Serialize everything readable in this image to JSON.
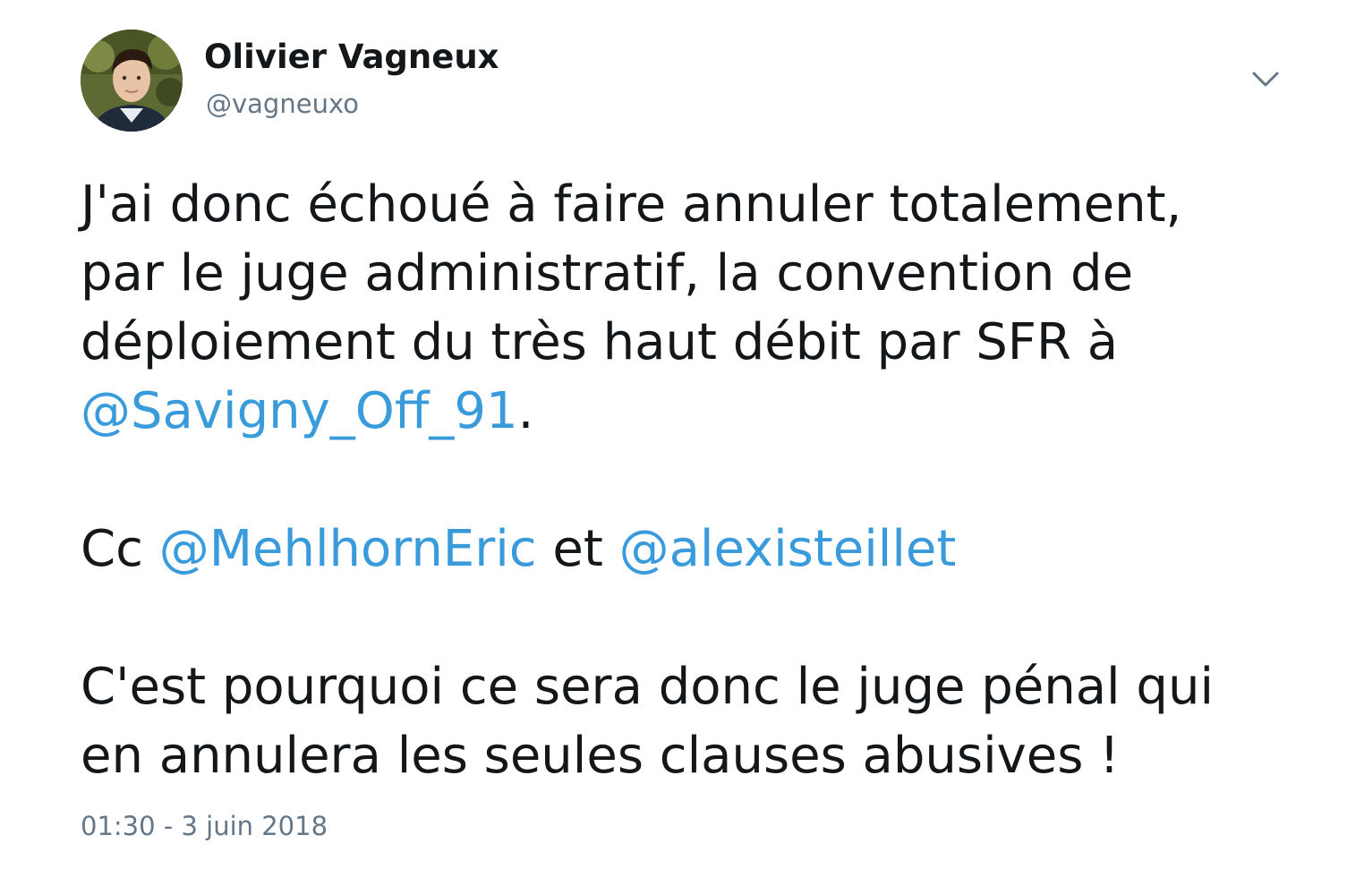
{
  "author": {
    "display_name": "Olivier Vagneux",
    "handle": "@vagneuxo",
    "avatar_icon": "profile-photo"
  },
  "menu": {
    "icon": "chevron-down-icon"
  },
  "tweet": {
    "paragraph1": {
      "line1": "J'ai donc échoué à faire annuler totalement,",
      "line2": "par le juge administratif, la convention de",
      "line3": "déploiement du très haut débit par SFR à",
      "mention": "@Savigny_Off_91",
      "after_mention": "."
    },
    "paragraph2": {
      "prefix": "Cc ",
      "mention1": "@MehlhornEric",
      "middle": " et ",
      "mention2": "@alexisteillet"
    },
    "paragraph3": {
      "line1": "C'est pourquoi ce sera donc le juge pénal qui",
      "line2": "en annulera les seules clauses abusives !"
    }
  },
  "timestamp": "01:30 - 3 juin 2018",
  "colors": {
    "text": "#14171a",
    "secondary": "#657786",
    "link": "#3a9bdc"
  }
}
